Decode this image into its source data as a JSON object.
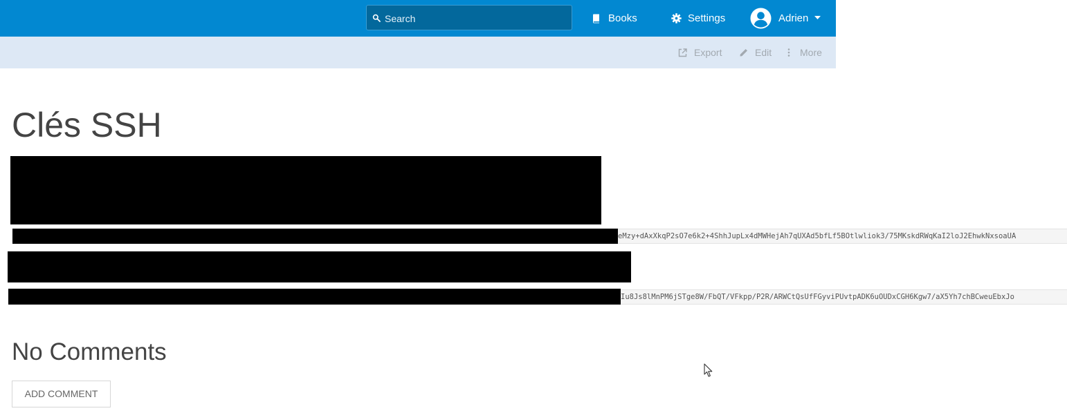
{
  "header": {
    "search_placeholder": "Search",
    "books_label": "Books",
    "settings_label": "Settings",
    "user_name": "Adrien"
  },
  "toolbar": {
    "export_label": "Export",
    "edit_label": "Edit",
    "more_label": "More"
  },
  "main": {
    "title": "Clés SSH",
    "key_line_1": "eMzy+dAxXkqP2sO7e6k2+4ShhJupLx4dMWHejAh7qUXAd5bfLf5BOtlwliok3/75MKskdRWqKaI2loJ2EhwkNxsoaUA",
    "key_line_2": "Iu8Js8lMnPM6jSTge8W/FbQT/VFkpp/P2R/ARWCtQsUfFGyviPUvtpADK6uOUDxCGH6Kgw7/aX5Yh7chBCweuEbxJo"
  },
  "comments": {
    "title": "No Comments",
    "add_label": "ADD COMMENT"
  },
  "colors": {
    "header_bg": "#0288d1",
    "toolbar_bg": "#dde8f5",
    "redaction": "#000000"
  }
}
